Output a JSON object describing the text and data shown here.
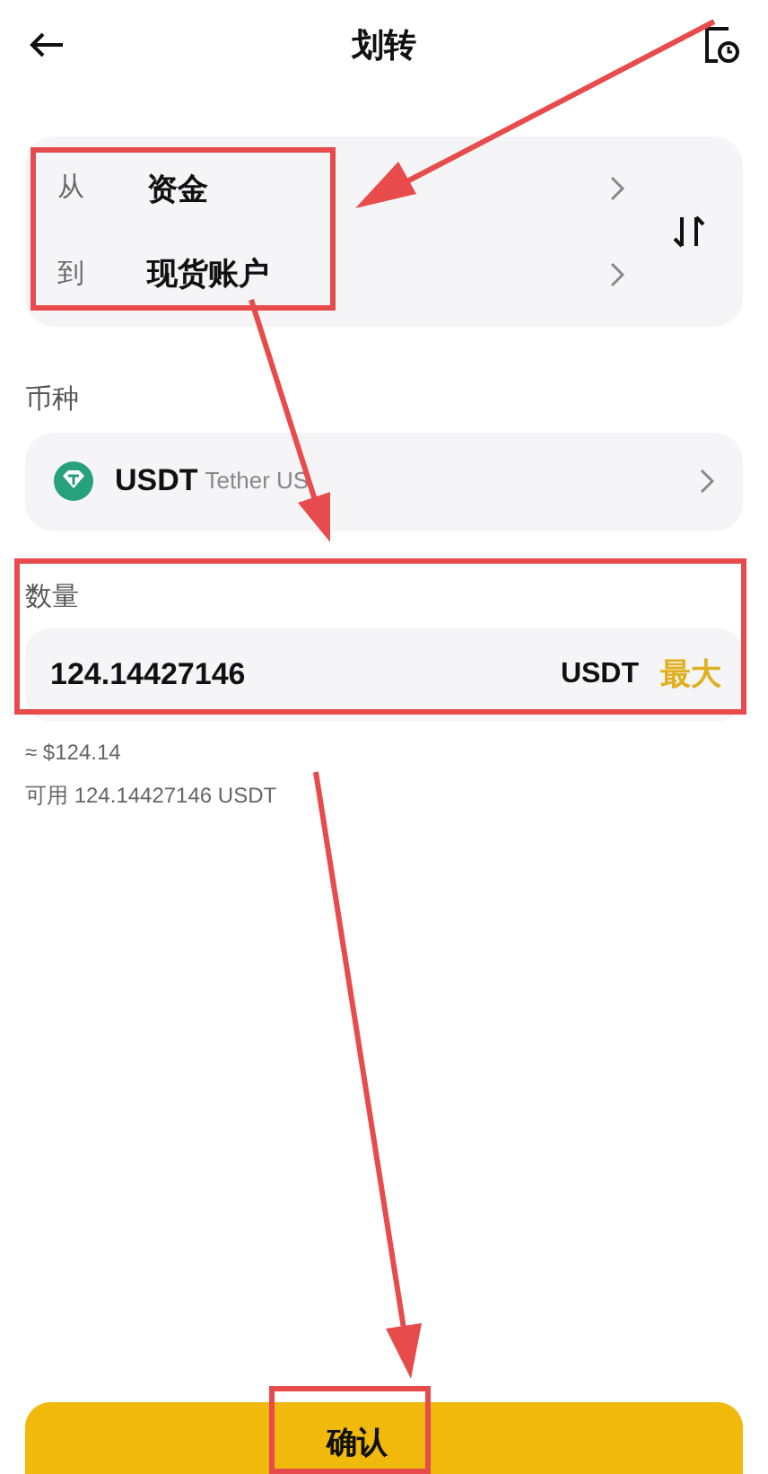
{
  "header": {
    "title": "划转"
  },
  "transfer": {
    "rows": [
      {
        "label": "从",
        "value": "资金"
      },
      {
        "label": "到",
        "value": "现货账户"
      }
    ]
  },
  "coin": {
    "label": "币种",
    "symbol": "USDT",
    "name": "Tether US"
  },
  "amount": {
    "label": "数量",
    "value": "124.14427146",
    "unit": "USDT",
    "max": "最大",
    "approx": "≈ $124.14",
    "available": "可用 124.14427146 USDT"
  },
  "confirm": {
    "label": "确认"
  }
}
